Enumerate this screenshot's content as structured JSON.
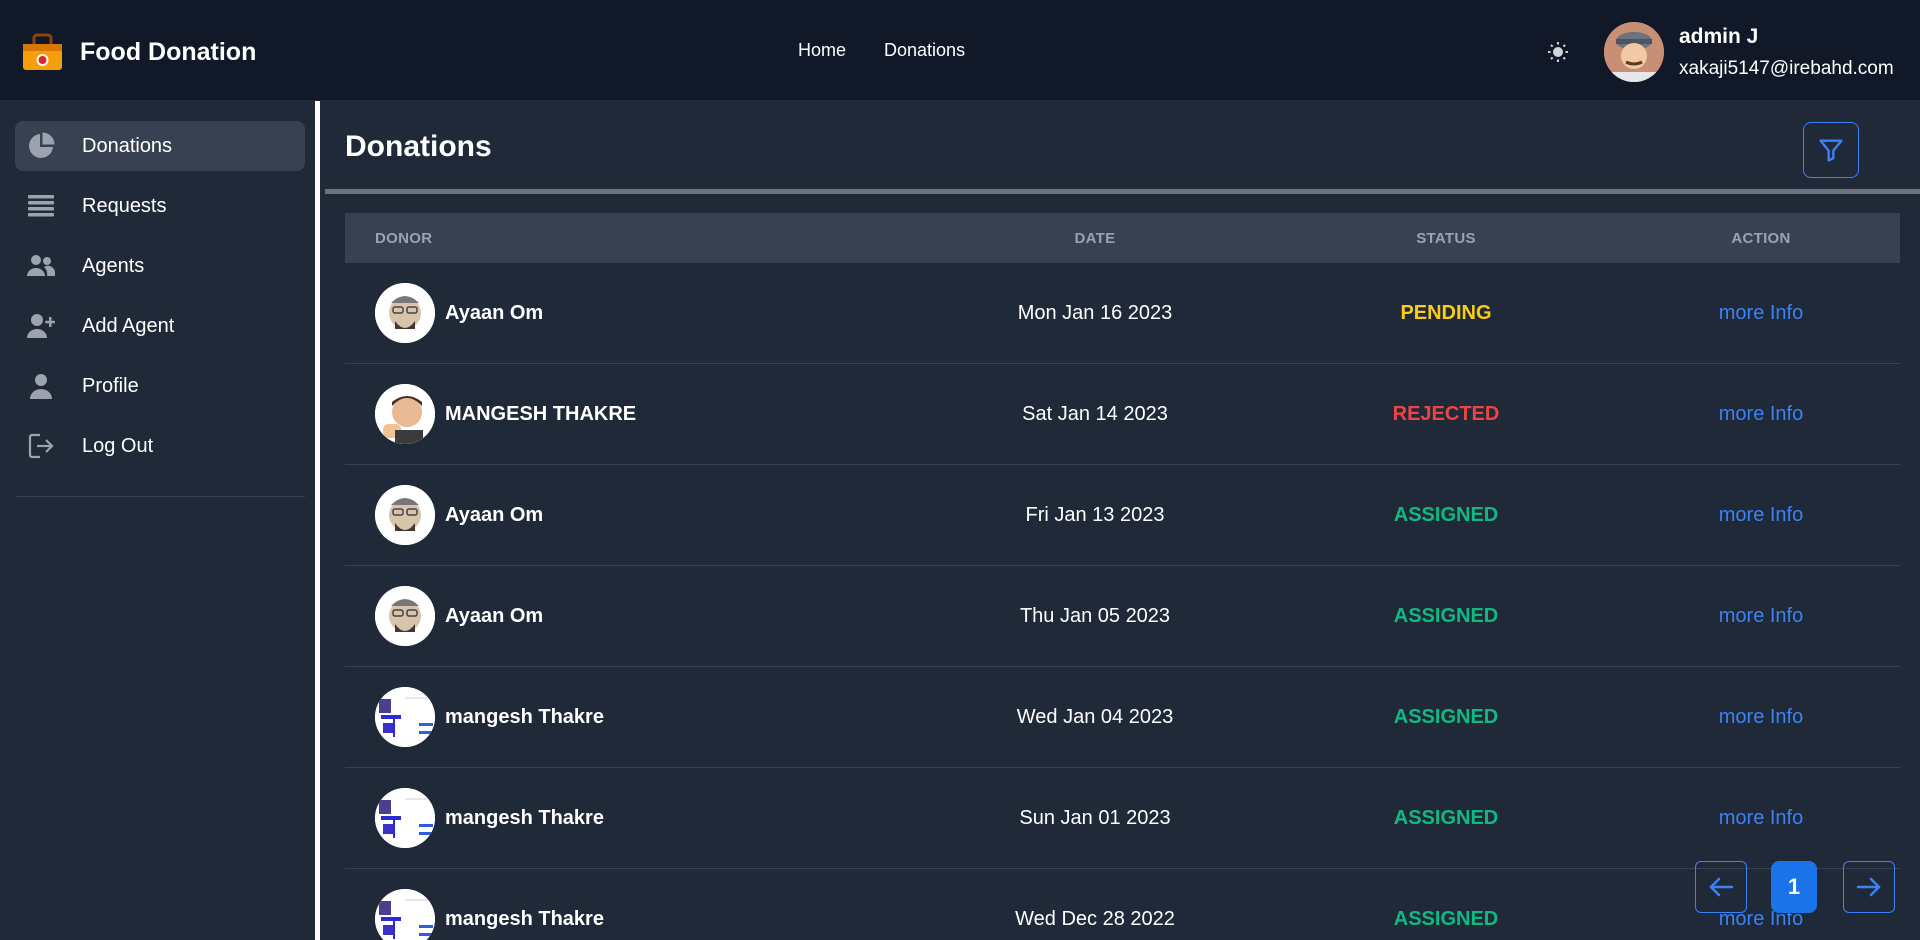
{
  "header": {
    "brand_name": "Food Donation",
    "nav": [
      "Home",
      "Donations"
    ],
    "user_name": "admin J",
    "user_email": "xakaji5147@irebahd.com"
  },
  "sidebar": {
    "items": [
      {
        "label": "Donations",
        "icon": "pie-chart-icon",
        "active": true
      },
      {
        "label": "Requests",
        "icon": "list-icon",
        "active": false
      },
      {
        "label": "Agents",
        "icon": "users-icon",
        "active": false
      },
      {
        "label": "Add Agent",
        "icon": "user-plus-icon",
        "active": false
      },
      {
        "label": "Profile",
        "icon": "user-icon",
        "active": false
      },
      {
        "label": "Log Out",
        "icon": "logout-icon",
        "active": false
      }
    ]
  },
  "main": {
    "title": "Donations",
    "table": {
      "headers": [
        "DONOR",
        "DATE",
        "STATUS",
        "ACTION"
      ],
      "rows": [
        {
          "donor": "Ayaan Om",
          "date": "Mon Jan 16 2023",
          "status": "PENDING",
          "action": "more Info"
        },
        {
          "donor": "MANGESH THAKRE",
          "date": "Sat Jan 14 2023",
          "status": "REJECTED",
          "action": "more Info"
        },
        {
          "donor": "Ayaan Om",
          "date": "Fri Jan 13 2023",
          "status": "ASSIGNED",
          "action": "more Info"
        },
        {
          "donor": "Ayaan Om",
          "date": "Thu Jan 05 2023",
          "status": "ASSIGNED",
          "action": "more Info"
        },
        {
          "donor": "mangesh Thakre",
          "date": "Wed Jan 04 2023",
          "status": "ASSIGNED",
          "action": "more Info"
        },
        {
          "donor": "mangesh Thakre",
          "date": "Sun Jan 01 2023",
          "status": "ASSIGNED",
          "action": "more Info"
        },
        {
          "donor": "mangesh Thakre",
          "date": "Wed Dec 28 2022",
          "status": "ASSIGNED",
          "action": "more Info"
        }
      ]
    },
    "pagination": {
      "current_page": "1"
    }
  },
  "colors": {
    "header_bg": "#111827",
    "body_bg": "#1f2937",
    "accent": "#3b82f6",
    "pending": "#facc15",
    "rejected": "#ef4444",
    "assigned": "#10b981"
  }
}
